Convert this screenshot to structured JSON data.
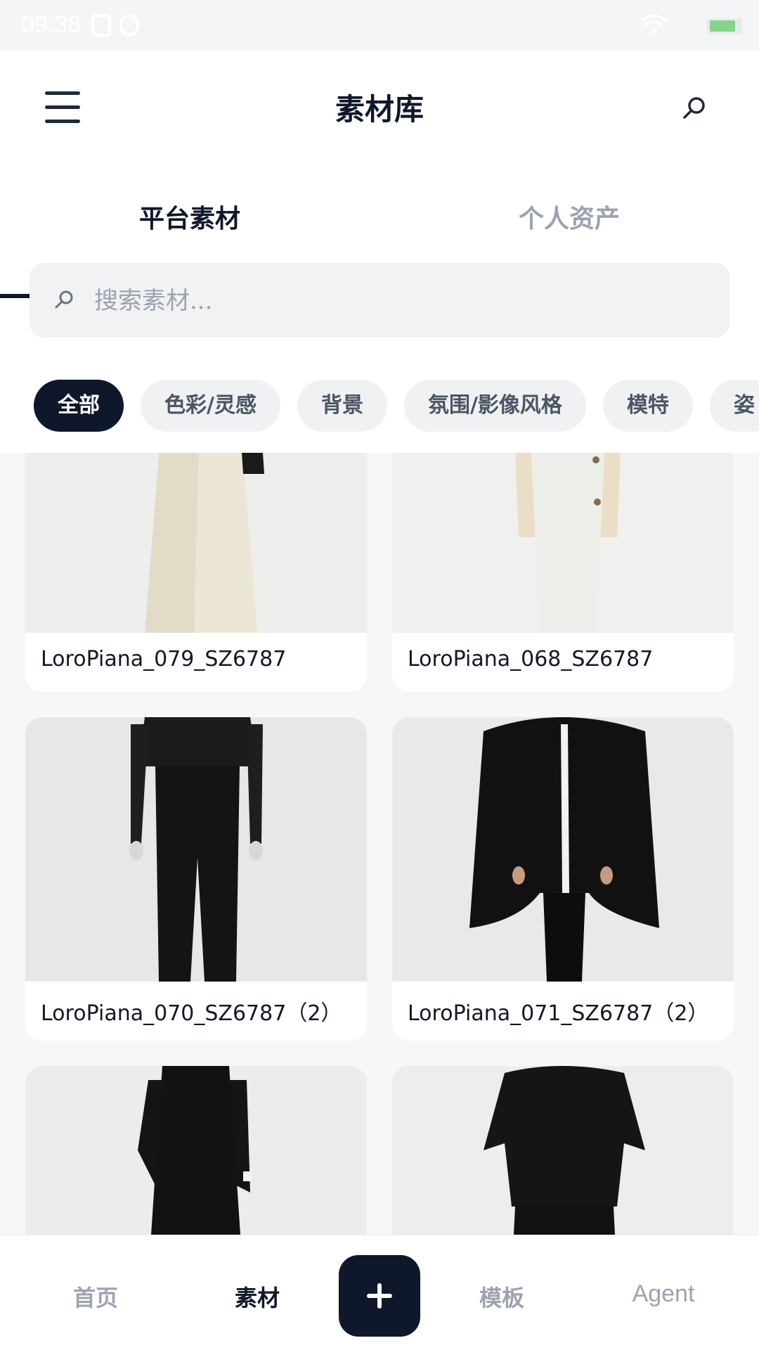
{
  "status_bar": {
    "time": "09:38",
    "battery_level": 0.85
  },
  "header": {
    "title": "素材库",
    "menu_icon": "hamburger-menu-icon",
    "search_icon": "search-icon"
  },
  "tabs": [
    {
      "label": "平台素材",
      "active": true
    },
    {
      "label": "个人资产",
      "active": false
    }
  ],
  "search": {
    "placeholder": "搜索素材..."
  },
  "chips": [
    {
      "label": "全部",
      "active": true
    },
    {
      "label": "色彩/灵感",
      "active": false
    },
    {
      "label": "背景",
      "active": false
    },
    {
      "label": "氛围/影像风格",
      "active": false
    },
    {
      "label": "模特",
      "active": false
    },
    {
      "label": "姿",
      "active": false
    }
  ],
  "cards": [
    {
      "label": "LoroPiana_079_SZ6787"
    },
    {
      "label": "LoroPiana_068_SZ6787"
    },
    {
      "label": "LoroPiana_070_SZ6787（2）"
    },
    {
      "label": "LoroPiana_071_SZ6787（2）"
    },
    {
      "label": ""
    },
    {
      "label": ""
    }
  ],
  "bottom_nav": {
    "home": "首页",
    "materials": "素材",
    "templates": "模板",
    "agent": "Agent",
    "add_icon": "plus-icon"
  },
  "colors": {
    "accent": "#0f172a",
    "chip_bg": "#f0f1f3",
    "muted": "#9ca3af"
  }
}
